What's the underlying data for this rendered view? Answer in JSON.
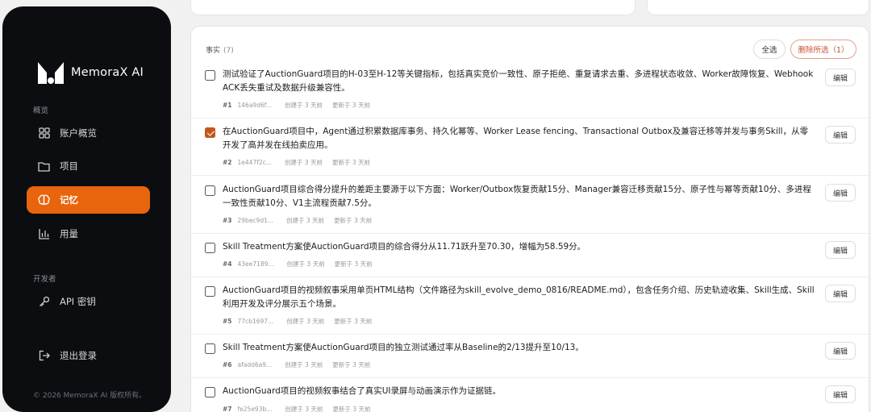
{
  "brand": {
    "name": "MemoraX AI"
  },
  "sidebar": {
    "section_overview": "概览",
    "section_developer": "开发者",
    "items": [
      {
        "label": "账户概览",
        "icon": "dashboard-icon"
      },
      {
        "label": "项目",
        "icon": "folder-icon"
      },
      {
        "label": "记忆",
        "icon": "brain-icon",
        "active": true
      },
      {
        "label": "用量",
        "icon": "bar-chart-icon"
      },
      {
        "label": "API 密钥",
        "icon": "key-icon"
      },
      {
        "label": "退出登录",
        "icon": "logout-icon"
      }
    ],
    "copyright": "© 2026 MemoraX AI 版权所有。"
  },
  "facts": {
    "title": "事实",
    "count": "(7)",
    "select_all": "全选",
    "delete_selected": "删除所选（1）",
    "edit_label": "编辑",
    "items": [
      {
        "num": "#1",
        "id": "146a9d6f...",
        "created": "创建于 3 天前",
        "updated": "更新于 3 天前",
        "checked": false,
        "text": "测试验证了AuctionGuard项目的H-03至H-12等关键指标，包括真实竞价一致性、原子拒绝、重复请求去重、多进程状态收敛、Worker故障恢复、Webhook ACK丢失重试及数据升级兼容性。"
      },
      {
        "num": "#2",
        "id": "1e447f2c...",
        "created": "创建于 3 天前",
        "updated": "更新于 3 天前",
        "checked": true,
        "text": "在AuctionGuard项目中，Agent通过积累数据库事务、持久化幂等、Worker Lease fencing、Transactional Outbox及兼容迁移等并发与事务Skill，从零开发了高并发在线拍卖应用。"
      },
      {
        "num": "#3",
        "id": "29bec9d1...",
        "created": "创建于 3 天前",
        "updated": "更新于 3 天前",
        "checked": false,
        "text": "AuctionGuard项目综合得分提升的差距主要源于以下方面：Worker/Outbox恢复贡献15分、Manager兼容迁移贡献15分、原子性与幂等贡献10分、多进程一致性贡献10分、V1主流程贡献7.5分。"
      },
      {
        "num": "#4",
        "id": "43ee7189...",
        "created": "创建于 3 天前",
        "updated": "更新于 3 天前",
        "checked": false,
        "text": "Skill Treatment方案使AuctionGuard项目的综合得分从11.71跃升至70.30，增幅为58.59分。"
      },
      {
        "num": "#5",
        "id": "77cb1697...",
        "created": "创建于 3 天前",
        "updated": "更新于 3 天前",
        "checked": false,
        "text": "AuctionGuard项目的视频叙事采用单页HTML结构（文件路径为skill_evolve_demo_0816/README.md），包含任务介绍、历史轨迹收集、Skill生成、Skill利用开发及评分展示五个场景。"
      },
      {
        "num": "#6",
        "id": "afadd6a9...",
        "created": "创建于 3 天前",
        "updated": "更新于 3 天前",
        "checked": false,
        "text": "Skill Treatment方案使AuctionGuard项目的独立测试通过率从Baseline的2/13提升至10/13。"
      },
      {
        "num": "#7",
        "id": "fe25e93b...",
        "created": "创建于 3 天前",
        "updated": "更新于 3 天前",
        "checked": false,
        "text": "AuctionGuard项目的视频叙事结合了真实UI录屏与动画演示作为证据链。"
      }
    ]
  }
}
